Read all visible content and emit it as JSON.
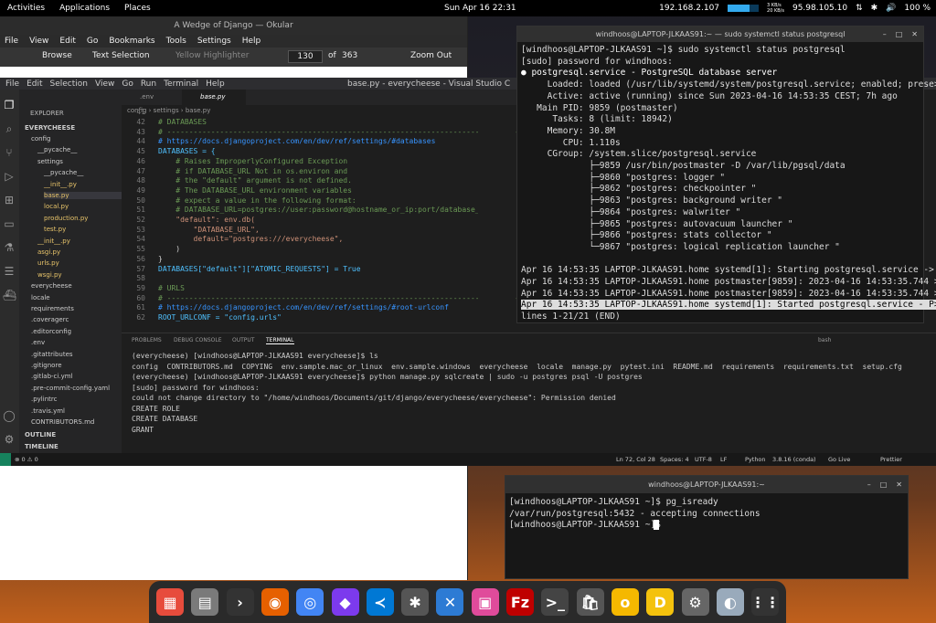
{
  "topbar": {
    "activities": "Activities",
    "applications": "Applications",
    "places": "Places",
    "clock": "Sun Apr 16  22:31",
    "ip_local": "192.168.2.107",
    "net_up": "3 KB/s",
    "net_down": "20 KB/s",
    "ip_public": "95.98.105.10",
    "battery": "100 %"
  },
  "okular": {
    "title": "A Wedge of Django — Okular",
    "menu": [
      "File",
      "View",
      "Edit",
      "Go",
      "Bookmarks",
      "Tools",
      "Settings",
      "Help"
    ],
    "browse": "Browse",
    "text_selection": "Text Selection",
    "highlighter": "Yellow Highlighter",
    "page": "130",
    "of": "of",
    "total": "363",
    "zoom_out": "Zoom Out"
  },
  "vscode": {
    "menu": [
      "File",
      "Edit",
      "Selection",
      "View",
      "Go",
      "Run",
      "Terminal",
      "Help"
    ],
    "title": "base.py - everycheese - Visual Studio C",
    "explorer": "EXPLORER",
    "project": "EVERYCHEESE",
    "tree": [
      "config",
      "__pycache__",
      "settings",
      "__pycache__",
      "__init__.py",
      "base.py",
      "local.py",
      "production.py",
      "test.py",
      "__init__.py",
      "asgi.py",
      "urls.py",
      "wsgi.py",
      "everycheese",
      "locale",
      "requirements",
      ".coveragerc",
      ".editorconfig",
      ".env",
      ".gitattributes",
      ".gitignore",
      ".gitlab-ci.yml",
      ".pre-commit-config.yaml",
      ".pylintrc",
      ".travis.yml",
      "CONTRIBUTORS.md"
    ],
    "outline": "OUTLINE",
    "timeline": "TIMELINE",
    "tabs": [
      ".env",
      "base.py"
    ],
    "breadcrumb": "config › settings › base.py",
    "line_numbers": [
      "41",
      "42",
      "43",
      "44",
      "45",
      "46",
      "47",
      "48",
      "49",
      "50",
      "51",
      "52",
      "53",
      "54",
      "55",
      "56",
      "57",
      "58",
      "59",
      "60",
      "61",
      "62"
    ],
    "code": [
      "",
      "# DATABASES",
      "# ------------------------------------------------------------------------------------------------",
      "# https://docs.djangoproject.com/en/dev/ref/settings/#databases",
      "DATABASES = {",
      "    # Raises ImproperlyConfigured Exception",
      "    # if DATABASE_URL Not in os.environ and",
      "    # the \"default\" argument is not defined.",
      "    # The DATABASE_URL environment variables",
      "    # expect a value in the following format:",
      "    # DATABASE_URL=postgres://user:password@hostname_or_ip:port/database_name",
      "    \"default\": env.db(",
      "        \"DATABASE_URL\",",
      "        default=\"postgres:///everycheese\",",
      "    )",
      "}",
      "DATABASES[\"default\"][\"ATOMIC_REQUESTS\"] = True",
      "",
      "# URLS",
      "# ------------------------------------------------------------------------------------------------",
      "# https://docs.djangoproject.com/en/dev/ref/settings/#root-urlconf",
      "ROOT_URLCONF = \"config.urls\""
    ],
    "panel_tabs": [
      "PROBLEMS",
      "DEBUG CONSOLE",
      "OUTPUT",
      "TERMINAL"
    ],
    "shell": "bash",
    "terminal": [
      "(everycheese) [windhoos@LAPTOP-JLKAAS91 everycheese]$ ls",
      "config  CONTRIBUTORS.md  COPYING  env.sample.mac_or_linux  env.sample.windows  everycheese  locale  manage.py  pytest.ini  README.md  requirements  requirements.txt  setup.cfg",
      "(everycheese) [windhoos@LAPTOP-JLKAAS91 everycheese]$ python manage.py sqlcreate | sudo -u postgres psql -U postgres",
      "[sudo] password for windhoos:",
      "could not change directory to \"/home/windhoos/Documents/git/django/everycheese/everycheese\": Permission denied",
      "CREATE ROLE",
      "CREATE DATABASE",
      "GRANT"
    ],
    "status": {
      "errors": "⊗ 0 ⚠ 0",
      "position": "Ln 72, Col 28",
      "spaces": "Spaces: 4",
      "encoding": "UTF-8",
      "eol": "LF",
      "language": "Python",
      "interpreter": "3.8.16 (conda)",
      "golive": "Go Live",
      "prettier": "Prettier"
    }
  },
  "term1": {
    "title": "windhoos@LAPTOP-JLKAAS91:~ — sudo systemctl status postgresql",
    "lines": [
      "[windhoos@LAPTOP-JLKAAS91 ~]$ sudo systemctl status postgresql",
      "[sudo] password for windhoos:",
      "● postgresql.service - PostgreSQL database server",
      "     Loaded: loaded (/usr/lib/systemd/system/postgresql.service; enabled; prese>",
      "     Active: active (running) since Sun 2023-04-16 14:53:35 CEST; 7h ago",
      "   Main PID: 9859 (postmaster)",
      "      Tasks: 8 (limit: 18942)",
      "     Memory: 30.8M",
      "        CPU: 1.110s",
      "     CGroup: /system.slice/postgresql.service",
      "             ├─9859 /usr/bin/postmaster -D /var/lib/pgsql/data",
      "             ├─9860 \"postgres: logger \"",
      "             ├─9862 \"postgres: checkpointer \"",
      "             ├─9863 \"postgres: background writer \"",
      "             ├─9864 \"postgres: walwriter \"",
      "             ├─9865 \"postgres: autovacuum launcher \"",
      "             ├─9866 \"postgres: stats collector \"",
      "             └─9867 \"postgres: logical replication launcher \"",
      "",
      "Apr 16 14:53:35 LAPTOP-JLKAAS91.home systemd[1]: Starting postgresql.service ->",
      "Apr 16 14:53:35 LAPTOP-JLKAAS91.home postmaster[9859]: 2023-04-16 14:53:35.744 >",
      "Apr 16 14:53:35 LAPTOP-JLKAAS91.home postmaster[9859]: 2023-04-16 14:53:35.744 >",
      "Apr 16 14:53:35 LAPTOP-JLKAAS91.home systemd[1]: Started postgresql.service - P>",
      "lines 1-21/21 (END)"
    ]
  },
  "term2": {
    "title": "windhoos@LAPTOP-JLKAAS91:~",
    "lines": [
      "[windhoos@LAPTOP-JLKAAS91 ~]$ pg_isready",
      "/var/run/postgresql:5432 - accepting connections",
      "[windhoos@LAPTOP-JLKAAS91 ~]$ "
    ]
  },
  "dock": [
    {
      "icon": "windows-icon",
      "c": "#e74c3c",
      "g": "▦"
    },
    {
      "icon": "files-icon",
      "c": "#7a7a7a",
      "g": "▤"
    },
    {
      "icon": "code-editor-icon",
      "c": "#333",
      "g": "›"
    },
    {
      "icon": "firefox-icon",
      "c": "#e66000",
      "g": "◉"
    },
    {
      "icon": "chrome-icon",
      "c": "#4285f4",
      "g": "◎"
    },
    {
      "icon": "obsidian-icon",
      "c": "#7c3aed",
      "g": "◆"
    },
    {
      "icon": "vscode-icon",
      "c": "#0078d4",
      "g": "≺"
    },
    {
      "icon": "kali-icon",
      "c": "#555",
      "g": "✱"
    },
    {
      "icon": "remote-desktop-icon",
      "c": "#2d7bd4",
      "g": "✕"
    },
    {
      "icon": "package-icon",
      "c": "#e04b9b",
      "g": "▣"
    },
    {
      "icon": "filezilla-icon",
      "c": "#bf0000",
      "g": "Fz"
    },
    {
      "icon": "terminal-icon",
      "c": "#444",
      "g": ">_"
    },
    {
      "icon": "app-store-icon",
      "c": "#555",
      "g": "🛍"
    },
    {
      "icon": "coin-icon",
      "c": "#f5b800",
      "g": "o"
    },
    {
      "icon": "d-app-icon",
      "c": "#f4c20d",
      "g": "D"
    },
    {
      "icon": "settings-gear-icon",
      "c": "#666",
      "g": "⚙"
    },
    {
      "icon": "disk-icon",
      "c": "#9ab",
      "g": "◐"
    },
    {
      "icon": "app-grid-icon",
      "c": "#333",
      "g": "⋮⋮"
    }
  ]
}
